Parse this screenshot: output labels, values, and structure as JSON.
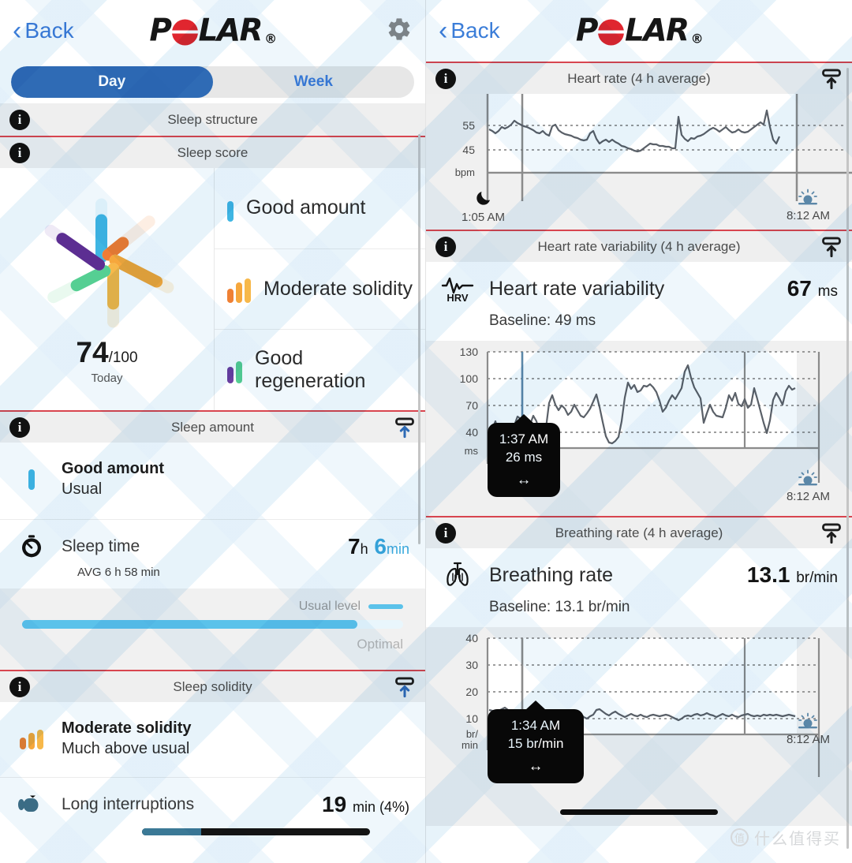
{
  "app": {
    "brand": "POLAR",
    "brand_mark": "®",
    "back_label": "Back",
    "gear_icon": "gear-icon"
  },
  "left_panel": {
    "tabs": [
      {
        "label": "Day",
        "active": true
      },
      {
        "label": "Week",
        "active": false
      }
    ],
    "sections": [
      {
        "id": "sleep-structure",
        "title": "Sleep structure",
        "info_icon": "info-icon"
      },
      {
        "id": "sleep-score",
        "title": "Sleep score",
        "info_icon": "info-icon"
      },
      {
        "id": "sleep-amount",
        "title": "Sleep amount",
        "info_icon": "info-icon",
        "collapse_icon": "collapse-icon"
      },
      {
        "id": "sleep-solidity",
        "title": "Sleep solidity",
        "info_icon": "info-icon",
        "collapse_icon": "collapse-icon"
      }
    ],
    "sleep_score": {
      "value": "74",
      "denominator": "/100",
      "period": "Today",
      "items": [
        {
          "label": "Good amount",
          "icon": "single-bar-icon",
          "colors": [
            "#3fb6e3"
          ]
        },
        {
          "label": "Moderate solidity",
          "icon": "triple-bar-icon",
          "colors": [
            "#ef8034",
            "#f6a73c",
            "#f7b84a"
          ]
        },
        {
          "label": "Good regeneration",
          "icon": "double-bar-icon",
          "colors": [
            "#6b3fa0",
            "#55cf93"
          ]
        }
      ]
    },
    "sleep_amount": {
      "rating_title": "Good amount",
      "rating_sub": "Usual",
      "rating_color": "#3fb6e3",
      "sleep_time_label": "Sleep time",
      "sleep_time_icon": "stopwatch-icon",
      "sleep_time_hours": "7",
      "sleep_time_hours_unit": "h",
      "sleep_time_minutes": "6",
      "sleep_time_minutes_unit": "min",
      "average": "AVG 6 h 58 min",
      "usual_level_label": "Usual level",
      "optimal_label": "Optimal",
      "fill_percent": 88
    },
    "sleep_solidity": {
      "rating_title": "Moderate solidity",
      "rating_sub": "Much above usual",
      "interruptions_label": "Long interruptions",
      "interruptions_icon": "interruption-icon",
      "interruptions_value": "19",
      "interruptions_unit": "min (4%)",
      "interruptions_fill_percent": 26
    }
  },
  "right_panel": {
    "sections": [
      {
        "id": "heart-rate",
        "title": "Heart rate (4 h average)"
      },
      {
        "id": "hrv",
        "title": "Heart rate variability (4 h average)"
      },
      {
        "id": "breathing",
        "title": "Breathing rate (4 h average)"
      }
    ],
    "hrv": {
      "icon": "hrv-icon",
      "icon_label": "HRV",
      "name": "Heart rate variability",
      "value": "67",
      "unit": "ms",
      "baseline": "Baseline: 49 ms",
      "tooltip": {
        "time": "1:37 AM",
        "value": "26 ms",
        "drag_icon": "drag-handle-icon"
      }
    },
    "breathing": {
      "icon": "lungs-icon",
      "name": "Breathing rate",
      "value": "13.1",
      "unit": "br/min",
      "baseline": "Baseline: 13.1 br/min",
      "tooltip": {
        "time": "1:34 AM",
        "value": "15 br/min",
        "drag_icon": "drag-handle-icon"
      }
    },
    "sleep_start": {
      "time": "1:05 AM",
      "icon": "moon-icon"
    },
    "sleep_end": {
      "time": "8:12 AM",
      "icon": "sunrise-icon"
    }
  },
  "watermark": {
    "logo_char": "值",
    "text": "什么值得买"
  },
  "chart_data": [
    {
      "type": "line",
      "title": "Heart rate (4 h average)",
      "ylabel": "bpm",
      "yticks": [
        45,
        55
      ],
      "ylim": [
        30,
        70
      ],
      "xlim_labels": [
        "1:05 AM",
        "8:12 AM"
      ],
      "grid": true,
      "series": [
        {
          "name": "Heart rate",
          "color": "#5a6068",
          "values": [
            53,
            52.5,
            51.5,
            52.5,
            54,
            53.5,
            54,
            55,
            56.5,
            55.5,
            55,
            54.5,
            54,
            53.5,
            53,
            52,
            51.5,
            52.5,
            51,
            50.5,
            54.5,
            55,
            53,
            52,
            51.5,
            51,
            50.5,
            50,
            49.5,
            49,
            48.5,
            49,
            51.5,
            52.5,
            49.5,
            47.5,
            48.5,
            49,
            48,
            49,
            48,
            47.5,
            46.5,
            46,
            45.5,
            45,
            44.5,
            44,
            44.5,
            45.5,
            46.5,
            47.5,
            47,
            47,
            46.5,
            46.5,
            46,
            46,
            45.5,
            45.5,
            57,
            50,
            48.5,
            47.5,
            49,
            48.5,
            49.5,
            50,
            50.5,
            51.5,
            52.5,
            53,
            52.5,
            51.5,
            52.5,
            53.5,
            52,
            51,
            51.5,
            52.5,
            51.5,
            51,
            51.5,
            52.5,
            53.5,
            54.5,
            53.5,
            59.5,
            52.5,
            47,
            45.5,
            48
          ]
        }
      ]
    },
    {
      "type": "line",
      "title": "Heart rate variability (4 h average)",
      "ylabel": "ms",
      "yticks": [
        40,
        70,
        100,
        130
      ],
      "ylim": [
        20,
        140
      ],
      "xlim_labels": [
        "1:05 AM",
        "8:12 AM"
      ],
      "grid": true,
      "current_value": 67,
      "baseline_value": 49,
      "series": [
        {
          "name": "HRV",
          "color": "#5a6068",
          "values": [
            42,
            47,
            56,
            43,
            38,
            30,
            34,
            42,
            51,
            61,
            58,
            46,
            41,
            52,
            62,
            56,
            43,
            40,
            48,
            76,
            85,
            74,
            68,
            73,
            70,
            63,
            66,
            74,
            68,
            62,
            60,
            65,
            70,
            78,
            86,
            72,
            55,
            40,
            33,
            32,
            34,
            38,
            56,
            82,
            99,
            92,
            96,
            88,
            90,
            95,
            94,
            97,
            93,
            88,
            78,
            66,
            70,
            78,
            84,
            80,
            86,
            92,
            110,
            117,
            103,
            92,
            86,
            80,
            54,
            64,
            74,
            66,
            62,
            61,
            60,
            70,
            84,
            78,
            86,
            74,
            72,
            80,
            70,
            74,
            92,
            80,
            68,
            54,
            44,
            56,
            74,
            82,
            76,
            70,
            84,
            90
          ]
        }
      ]
    },
    {
      "type": "line",
      "title": "Breathing rate (4 h average)",
      "ylabel": "br/min",
      "yticks": [
        10,
        20,
        30,
        40
      ],
      "ylim": [
        0,
        45
      ],
      "xlim_labels": [
        "1:05 AM",
        "8:12 AM"
      ],
      "grid": true,
      "current_value": 13.1,
      "baseline_value": 13.1,
      "series": [
        {
          "name": "Breathing rate",
          "color": "#5a6068",
          "values": [
            14.5,
            14.2,
            14.0,
            14.3,
            14.8,
            15.2,
            14.6,
            14.2,
            14.0,
            13.8,
            14.1,
            13.9,
            14.0,
            13.7,
            13.6,
            13.9,
            14.1,
            13.8,
            13.5,
            13.4,
            13.6,
            13.8,
            13.5,
            13.2,
            13.4,
            13.6,
            13.3,
            13.1,
            13.0,
            13.4,
            12.6,
            12.2,
            12.8,
            13.4,
            14.6,
            14.9,
            14.2,
            13.6,
            13.2,
            13.8,
            14.3,
            13.7,
            13.2,
            12.9,
            13.3,
            13.6,
            13.2,
            13.0,
            13.4,
            13.1,
            12.9,
            13.2,
            13.5,
            13.3,
            13.0,
            13.2,
            13.4,
            13.1,
            12.8,
            12.4,
            11.9,
            12.4,
            12.9,
            13.3,
            13.0,
            13.4,
            13.6,
            13.2,
            13.5,
            13.8,
            13.4,
            13.1,
            12.8,
            13.2,
            13.5,
            13.1,
            12.9,
            13.3,
            13.0,
            12.7,
            13.1,
            13.4,
            13.6,
            13.2,
            12.9,
            13.2,
            13.5,
            13.2,
            13.0,
            13.3,
            13.1
          ]
        }
      ]
    }
  ]
}
